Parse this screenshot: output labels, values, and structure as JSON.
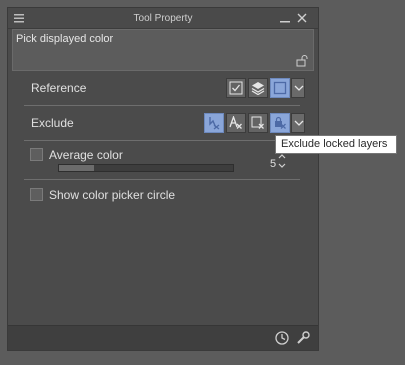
{
  "window": {
    "title": "Tool Property"
  },
  "tool": {
    "name": "Pick displayed color"
  },
  "reference": {
    "label": "Reference",
    "buttons": [
      {
        "icon": "checkbox-icon",
        "active": false
      },
      {
        "icon": "layers-icon",
        "active": false
      },
      {
        "icon": "frame-icon",
        "active": true
      }
    ]
  },
  "exclude": {
    "label": "Exclude",
    "buttons": [
      {
        "icon": "exclude-paper-icon",
        "active": true
      },
      {
        "icon": "exclude-text-icon",
        "active": false
      },
      {
        "icon": "exclude-edit-icon",
        "active": false
      },
      {
        "icon": "exclude-locked-icon",
        "active": true
      }
    ]
  },
  "average_color": {
    "label": "Average color",
    "value": "5",
    "checked": false,
    "level": 0.2
  },
  "show_picker_circle": {
    "label": "Show color picker circle",
    "checked": false
  },
  "tooltip": {
    "text": "Exclude locked layers"
  },
  "colors": {
    "accent": "#8aa6d9",
    "panel": "#4b4b4b",
    "background": "#5c5c5c"
  }
}
